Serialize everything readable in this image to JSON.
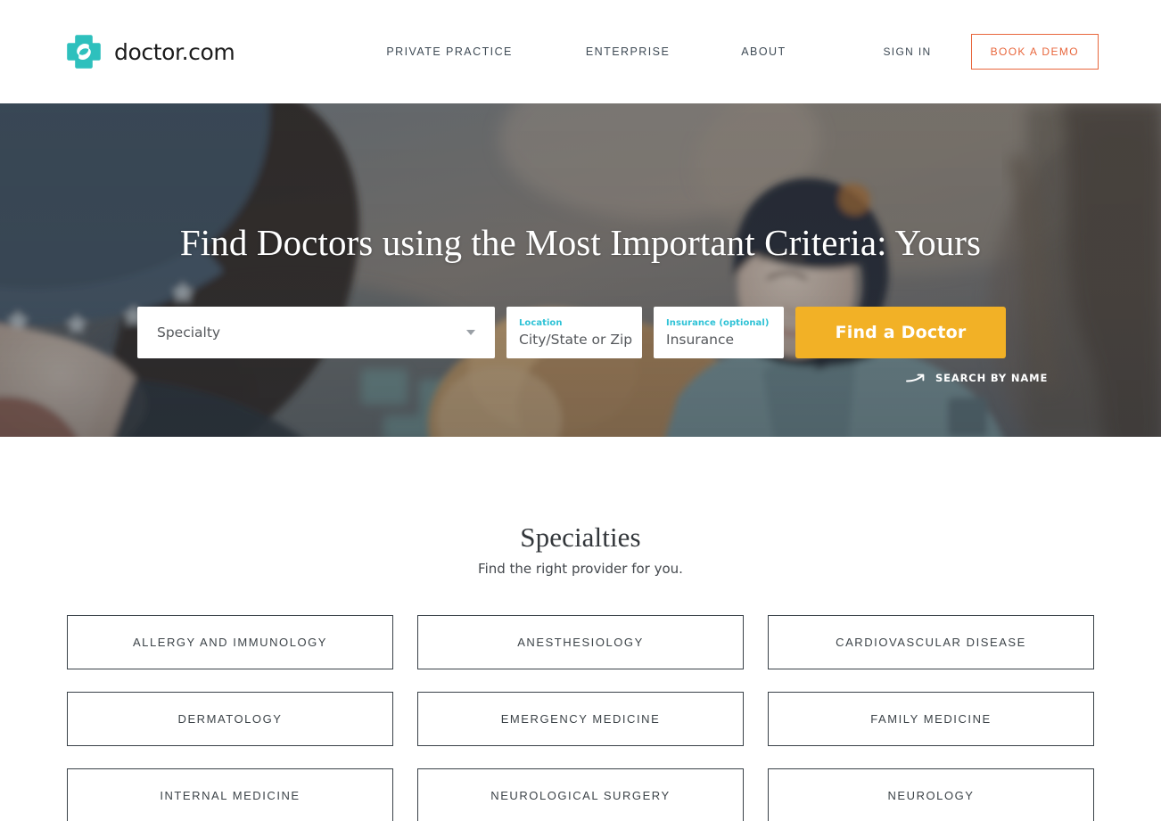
{
  "nav": {
    "brand_name": "doctor.com",
    "logo_icon": "medical-cross-swoosh-logo",
    "links": [
      {
        "label": "PRIVATE PRACTICE"
      },
      {
        "label": "ENTERPRISE"
      },
      {
        "label": "ABOUT"
      }
    ],
    "sign_in_label": "SIGN IN",
    "book_demo_label": "BOOK A DEMO",
    "accent_teal": "#2ec0bd",
    "accent_orange": "#e8663c",
    "text_color": "#3e4a55"
  },
  "hero": {
    "title": "Find Doctors using the Most Important Criteria: Yours",
    "background_image": "children-with-dog-outdoors-winter-photo",
    "search": {
      "specialty": {
        "placeholder": "Specialty",
        "caret_icon": "chevron-down-icon"
      },
      "location": {
        "label": "Location",
        "placeholder": "City/State or Zip",
        "value": ""
      },
      "insurance": {
        "label": "Insurance (optional)",
        "placeholder": "Insurance",
        "value": ""
      },
      "submit_label": "Find a Doctor",
      "submit_color": "#f2b126"
    },
    "search_by_name": {
      "label": "SEARCH BY NAME",
      "icon": "arrow-right-icon"
    },
    "label_color": "#2ec2d6"
  },
  "specialties": {
    "title": "Specialties",
    "subtitle": "Find the right provider for you.",
    "cards": [
      {
        "label": "ALLERGY AND IMMUNOLOGY"
      },
      {
        "label": "ANESTHESIOLOGY"
      },
      {
        "label": "CARDIOVASCULAR DISEASE"
      },
      {
        "label": "DERMATOLOGY"
      },
      {
        "label": "EMERGENCY MEDICINE"
      },
      {
        "label": "FAMILY MEDICINE"
      },
      {
        "label": "INTERNAL MEDICINE"
      },
      {
        "label": "NEUROLOGICAL SURGERY"
      },
      {
        "label": "NEUROLOGY"
      }
    ]
  }
}
